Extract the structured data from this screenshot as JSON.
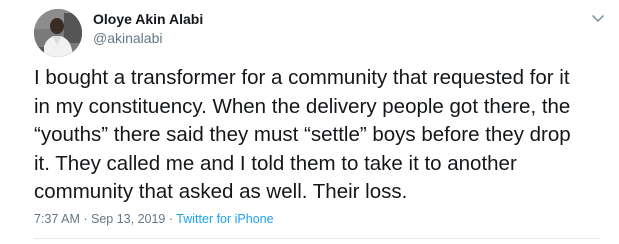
{
  "author": {
    "name": "Oloye Akin Alabi",
    "handle": "@akinalabi"
  },
  "tweet": {
    "lines": [
      "I bought a transformer for a community that requested for it",
      "in my constituency. When the delivery people got there, the",
      "“youths” there said they must “settle” boys before they drop",
      "it. They called me and I told them to take it to another",
      "community that asked as well. Their loss."
    ]
  },
  "meta": {
    "time": "7:37 AM",
    "separator": "·",
    "date": "Sep 13, 2019",
    "source": "Twitter for iPhone"
  },
  "icons": {
    "menu": "chevron-down-icon",
    "avatar": "profile-photo"
  },
  "colors": {
    "text": "#14171a",
    "secondary": "#657786",
    "link": "#1da1f2",
    "divider": "#e6ecf0"
  }
}
